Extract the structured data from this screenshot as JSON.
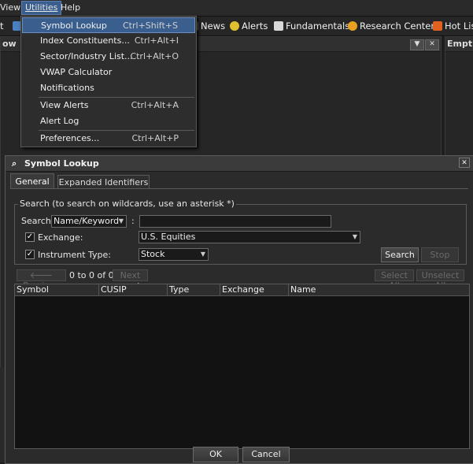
{
  "menubar": {
    "items": [
      {
        "label": "View"
      },
      {
        "label": "Utilities"
      },
      {
        "label": "Help"
      }
    ]
  },
  "toolbar": {
    "buttons": [
      {
        "label": "t",
        "icon": "partial-icon"
      },
      {
        "label": "News",
        "icon": "news-icon"
      },
      {
        "label": "Alerts",
        "icon": "alert-bell-icon"
      },
      {
        "label": "Fundamentals",
        "icon": "fundamentals-icon"
      },
      {
        "label": "Research Center",
        "icon": "research-icon"
      },
      {
        "label": "Hot List",
        "icon": "hotlist-icon"
      }
    ]
  },
  "panels": {
    "left_title": "ow",
    "right_title": "Empt"
  },
  "utilities_menu": {
    "items": [
      {
        "label": "Symbol Lookup",
        "shortcut": "Ctrl+Shift+S",
        "highlighted": true
      },
      {
        "label": "Index Constituents...",
        "shortcut": "Ctrl+Alt+I"
      },
      {
        "label": "Sector/Industry List...",
        "shortcut": "Ctrl+Alt+O"
      },
      {
        "label": "VWAP Calculator",
        "shortcut": ""
      },
      {
        "label": "Notifications",
        "shortcut": ""
      },
      {
        "label": "View Alerts",
        "shortcut": "Ctrl+Alt+A"
      },
      {
        "label": "Alert Log",
        "shortcut": ""
      },
      {
        "label": "Preferences...",
        "shortcut": "Ctrl+Alt+P"
      }
    ]
  },
  "dialog": {
    "title": "Symbol Lookup",
    "close_glyph": "✕",
    "tabs": [
      {
        "label": "General",
        "active": true
      },
      {
        "label": "Expanded Identifiers",
        "active": false
      }
    ],
    "search_group_label": "Search (to search on wildcards, use an asterisk *)",
    "search_label": "Search",
    "search_mode": "Name/Keyword",
    "search_colon": ":",
    "search_value": "",
    "exchange_label": "Exchange:",
    "exchange_checked": true,
    "exchange_value": "U.S. Equities",
    "instrument_label": "Instrument Type:",
    "instrument_checked": true,
    "instrument_value": "Stock",
    "search_button": "Search",
    "stop_button": "Stop",
    "previous_button": "Previous",
    "page_range": "0 to 0 of 0",
    "next_button": "Next",
    "select_all_button": "Select All",
    "unselect_all_button": "Unselect All",
    "columns": [
      "Symbol",
      "CUSIP",
      "Type",
      "Exchange",
      "Name"
    ],
    "ok_button": "OK",
    "cancel_button": "Cancel"
  },
  "colors": {
    "menu_highlight": "#3a5f8f",
    "background": "#1e1e1e",
    "dialog": "#2b2b2b"
  }
}
